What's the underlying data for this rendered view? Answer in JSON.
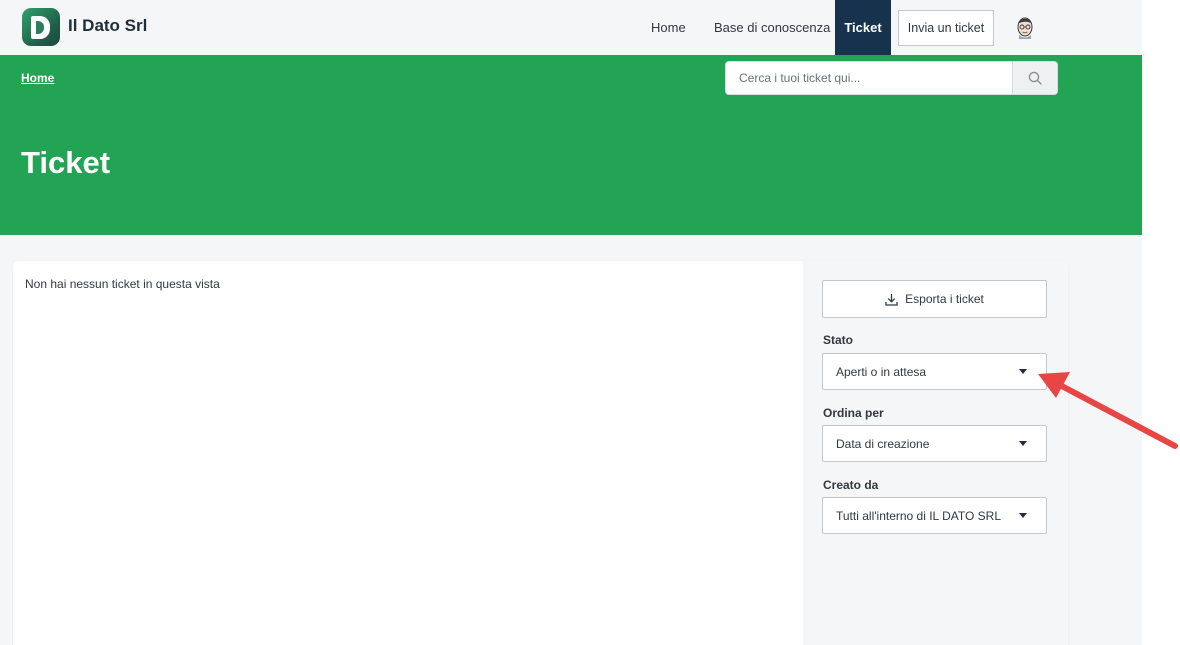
{
  "header": {
    "brand": "Il Dato Srl",
    "nav": {
      "home": "Home",
      "knowledge_base": "Base di conoscenza",
      "tickets": "Ticket"
    },
    "submit_ticket": "Invia un ticket"
  },
  "hero": {
    "breadcrumb": "Home",
    "search_placeholder": "Cerca i tuoi ticket qui...",
    "title": "Ticket"
  },
  "content": {
    "empty_message": "Non hai nessun ticket in questa vista"
  },
  "sidebar": {
    "export_label": "Esporta i ticket",
    "status": {
      "label": "Stato",
      "value": "Aperti o in attesa"
    },
    "sort": {
      "label": "Ordina per",
      "value": "Data di creazione"
    },
    "created_by": {
      "label": "Creato da",
      "value": "Tutti all'interno di IL DATO SRL"
    }
  },
  "colors": {
    "hero_green": "#22a454",
    "active_nav": "#17324d",
    "annotation_arrow": "#e84545"
  }
}
